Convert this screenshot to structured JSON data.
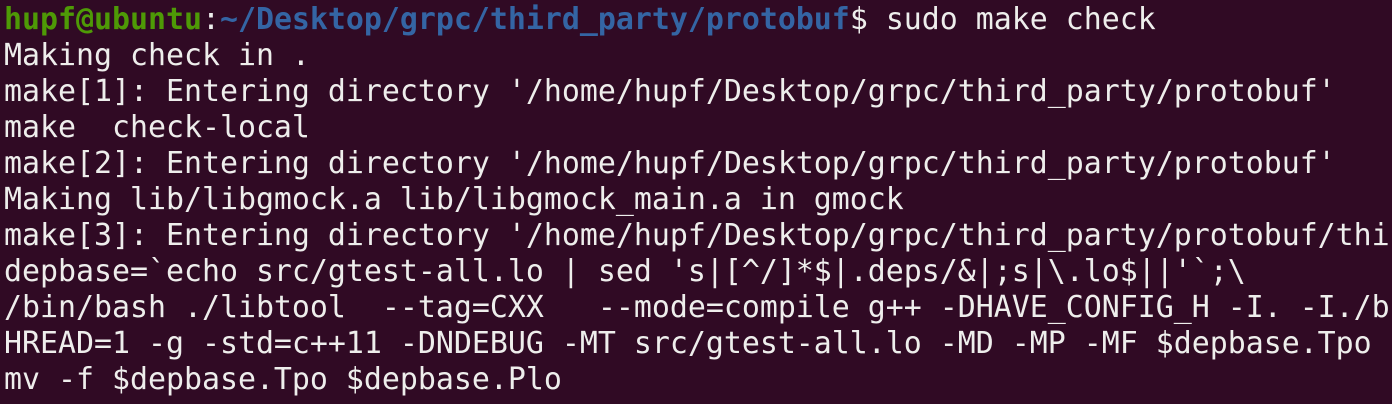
{
  "terminal": {
    "prompt": {
      "user_host": "hupf@ubuntu",
      "separator": ":",
      "cwd": "~/Desktop/grpc/third_party/protobuf",
      "symbol": "$ ",
      "command": "sudo make check"
    },
    "output_lines": [
      "Making check in .",
      "make[1]: Entering directory '/home/hupf/Desktop/grpc/third_party/protobuf'",
      "make  check-local",
      "make[2]: Entering directory '/home/hupf/Desktop/grpc/third_party/protobuf'",
      "Making lib/libgmock.a lib/libgmock_main.a in gmock",
      "make[3]: Entering directory '/home/hupf/Desktop/grpc/third_party/protobuf/thi",
      "depbase=`echo src/gtest-all.lo | sed 's|[^/]*$|.deps/&|;s|\\.lo$||'`;\\",
      "/bin/bash ./libtool  --tag=CXX   --mode=compile g++ -DHAVE_CONFIG_H -I. -I./b",
      "HREAD=1 -g -std=c++11 -DNDEBUG -MT src/gtest-all.lo -MD -MP -MF $depbase.Tpo",
      "mv -f $depbase.Tpo $depbase.Plo"
    ],
    "colors": {
      "background": "#300a24",
      "text": "#eeeeec",
      "user": "#4e9a06",
      "path": "#3465a4"
    }
  }
}
